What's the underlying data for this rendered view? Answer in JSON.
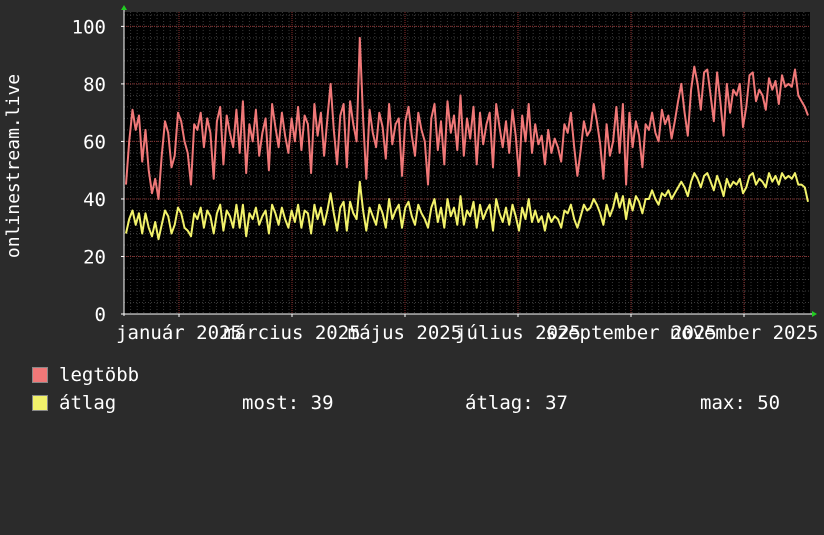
{
  "chart_data": {
    "type": "line",
    "ylabel": "onlinestream.live",
    "ylim": [
      0,
      105
    ],
    "yticks": [
      0,
      20,
      40,
      60,
      80,
      100
    ],
    "x_tick_labels": [
      "január 2025",
      "március 2025",
      "május 2025",
      "július 2025",
      "szeptember 2025",
      "november 2025"
    ],
    "grid": true,
    "series": [
      {
        "name": "legtöbb",
        "color": "#f07878",
        "values": [
          45,
          60,
          71,
          64,
          69,
          53,
          64,
          50,
          42,
          47,
          40,
          55,
          67,
          63,
          51,
          55,
          70,
          67,
          60,
          56,
          45,
          66,
          64,
          70,
          58,
          68,
          63,
          47,
          67,
          72,
          52,
          69,
          63,
          58,
          71,
          56,
          74,
          49,
          66,
          60,
          71,
          55,
          63,
          68,
          50,
          73,
          65,
          58,
          70,
          62,
          56,
          68,
          60,
          72,
          57,
          69,
          66,
          49,
          73,
          62,
          70,
          55,
          68,
          80,
          64,
          52,
          69,
          73,
          51,
          74,
          66,
          60,
          96,
          68,
          47,
          71,
          63,
          58,
          70,
          65,
          54,
          73,
          59,
          66,
          68,
          48,
          67,
          72,
          62,
          55,
          70,
          64,
          60,
          45,
          68,
          73,
          57,
          67,
          52,
          74,
          63,
          69,
          57,
          76,
          55,
          68,
          61,
          72,
          52,
          70,
          59,
          66,
          70,
          51,
          73,
          65,
          58,
          67,
          56,
          71,
          62,
          48,
          69,
          60,
          73,
          56,
          66,
          59,
          62,
          52,
          64,
          56,
          61,
          58,
          53,
          66,
          63,
          70,
          58,
          48,
          57,
          67,
          62,
          64,
          73,
          67,
          59,
          47,
          66,
          55,
          60,
          72,
          56,
          73,
          45,
          70,
          58,
          67,
          62,
          51,
          66,
          64,
          70,
          63,
          60,
          71,
          66,
          69,
          61,
          67,
          74,
          80,
          70,
          62,
          78,
          86,
          80,
          71,
          84,
          85,
          76,
          67,
          84,
          74,
          62,
          80,
          70,
          78,
          76,
          80,
          65,
          72,
          83,
          84,
          74,
          78,
          76,
          71,
          82,
          78,
          81,
          73,
          83,
          79,
          80,
          79,
          85,
          76,
          74,
          72,
          69
        ]
      },
      {
        "name": "átlag",
        "color": "#f2f26b",
        "values": [
          28,
          33,
          36,
          31,
          35,
          28,
          35,
          30,
          27,
          32,
          26,
          31,
          36,
          34,
          28,
          31,
          37,
          35,
          30,
          29,
          27,
          35,
          33,
          37,
          30,
          36,
          34,
          28,
          35,
          38,
          29,
          36,
          34,
          30,
          38,
          30,
          38,
          27,
          35,
          33,
          37,
          31,
          34,
          36,
          28,
          38,
          35,
          31,
          37,
          33,
          30,
          36,
          32,
          38,
          30,
          36,
          35,
          28,
          38,
          33,
          37,
          31,
          36,
          42,
          35,
          29,
          37,
          39,
          29,
          39,
          35,
          33,
          46,
          36,
          29,
          37,
          34,
          31,
          38,
          35,
          30,
          40,
          33,
          36,
          38,
          30,
          37,
          39,
          34,
          31,
          38,
          35,
          33,
          30,
          37,
          40,
          32,
          37,
          30,
          40,
          34,
          37,
          31,
          41,
          31,
          36,
          34,
          39,
          30,
          38,
          33,
          36,
          38,
          29,
          40,
          35,
          32,
          37,
          31,
          38,
          34,
          29,
          37,
          33,
          40,
          32,
          36,
          32,
          34,
          29,
          35,
          32,
          34,
          33,
          30,
          36,
          35,
          38,
          33,
          30,
          34,
          38,
          36,
          37,
          40,
          38,
          35,
          31,
          38,
          34,
          37,
          42,
          37,
          41,
          33,
          40,
          36,
          41,
          39,
          35,
          40,
          40,
          43,
          40,
          38,
          42,
          41,
          43,
          40,
          42,
          44,
          46,
          44,
          41,
          46,
          49,
          47,
          44,
          48,
          49,
          46,
          43,
          48,
          45,
          41,
          47,
          44,
          46,
          45,
          47,
          42,
          44,
          48,
          49,
          45,
          47,
          46,
          44,
          49,
          46,
          48,
          45,
          49,
          47,
          48,
          47,
          49,
          45,
          45,
          44,
          39
        ]
      }
    ]
  },
  "legend": {
    "max_label": "legtöbb",
    "avg_label": "átlag",
    "stats": {
      "current": "most: 39",
      "average": "átlag: 37",
      "max": "max: 50"
    }
  }
}
